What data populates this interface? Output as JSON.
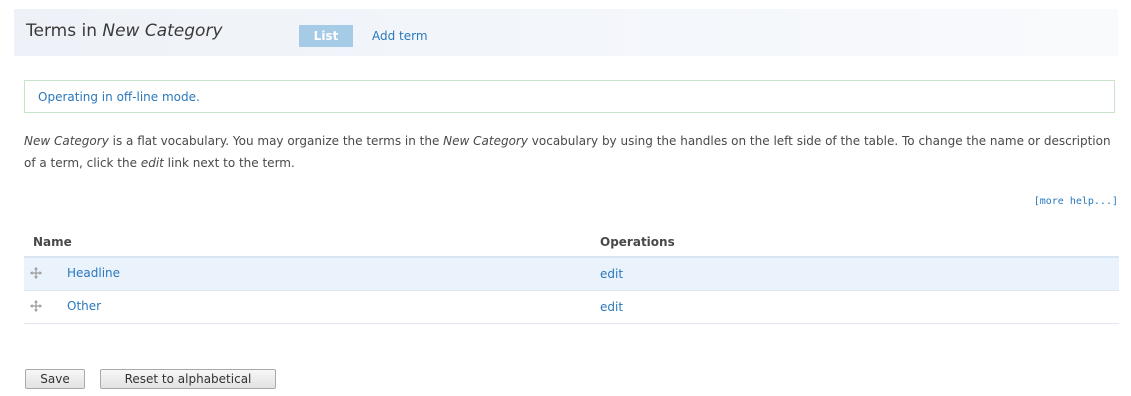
{
  "header": {
    "title_prefix": "Terms in ",
    "title_category": "New Category",
    "tabs": [
      {
        "label": "List",
        "active": true
      },
      {
        "label": "Add term",
        "active": false
      }
    ]
  },
  "status": {
    "message": "Operating in off-line mode."
  },
  "description": {
    "part1": "New Category",
    "part2": " is a flat vocabulary. You may organize the terms in the ",
    "part3": "New Category",
    "part4": " vocabulary by using the handles on the left side of the table. To change the name or description of a term, click the ",
    "part5": "edit",
    "part6": " link next to the term."
  },
  "more_help": "[more help...]",
  "table": {
    "columns": [
      "Name",
      "Operations"
    ],
    "rows": [
      {
        "name": "Headline",
        "operation": "edit"
      },
      {
        "name": "Other",
        "operation": "edit"
      }
    ]
  },
  "buttons": {
    "save": "Save",
    "reset": "Reset to alphabetical"
  },
  "colors": {
    "link": "#2a78bd",
    "active_tab_bg": "#a6cbe6",
    "status_border": "#c8e3c8",
    "row_highlight": "#eaf2fb"
  },
  "icons": {
    "drag_handle": "drag-handle-icon"
  }
}
